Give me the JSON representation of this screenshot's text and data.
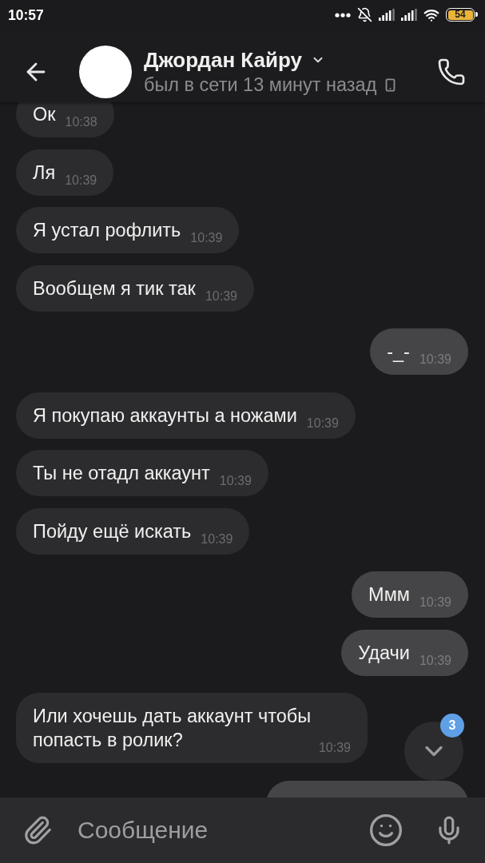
{
  "status_bar": {
    "time": "10:57",
    "battery": "54"
  },
  "header": {
    "name": "Джордан Кайру",
    "last_seen": "был в сети 13 минут назад"
  },
  "messages": [
    {
      "outgoing": false,
      "text": "Ок",
      "time": "10:38"
    },
    {
      "outgoing": false,
      "text": "Ля",
      "time": "10:39"
    },
    {
      "outgoing": false,
      "text": "Я устал рофлить",
      "time": "10:39"
    },
    {
      "outgoing": false,
      "text": "Вообщем я тик так",
      "time": "10:39"
    },
    {
      "outgoing": true,
      "text": "-_-",
      "time": "10:39"
    },
    {
      "outgoing": false,
      "text": "Я покупаю аккаунты а ножами",
      "time": "10:39"
    },
    {
      "outgoing": false,
      "text": "Ты не отадл аккаунт",
      "time": "10:39"
    },
    {
      "outgoing": false,
      "text": "Пойду ещё искать",
      "time": "10:39"
    },
    {
      "outgoing": true,
      "text": "Ммм",
      "time": "10:39"
    },
    {
      "outgoing": true,
      "text": "Удачи",
      "time": "10:39"
    },
    {
      "outgoing": false,
      "text": "Или хочешь дать аккаунт чтобы попасть в ролик?",
      "time": "10:39"
    },
    {
      "outgoing": true
    }
  ],
  "scroll_button": {
    "unread": "3"
  },
  "composer": {
    "placeholder": "Сообщение"
  }
}
